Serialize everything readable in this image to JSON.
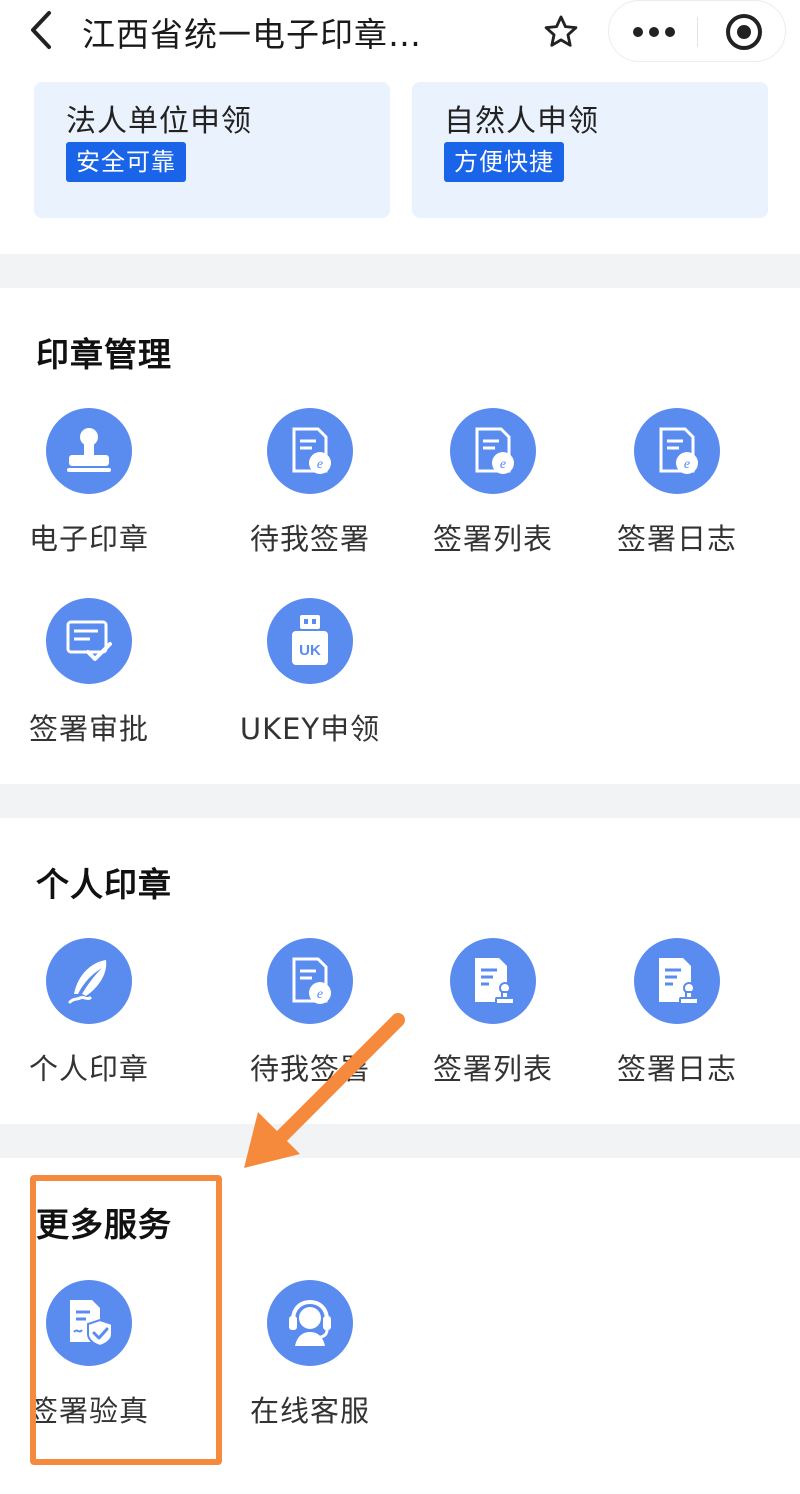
{
  "header": {
    "title": "江西省统一电子印章…",
    "back_icon": "chevron-left-icon",
    "star_icon": "star-icon",
    "more_icon": "more-dots-icon",
    "close_icon": "target-circle-icon"
  },
  "apply_cards": [
    {
      "title": "法人单位申领",
      "tag": "安全可靠"
    },
    {
      "title": "自然人申领",
      "tag": "方便快捷"
    }
  ],
  "sections": {
    "seal_management": {
      "title": "印章管理",
      "items": [
        {
          "label": "电子印章",
          "icon": "stamp-icon"
        },
        {
          "label": "待我签署",
          "icon": "e-sign-document-icon"
        },
        {
          "label": "签署列表",
          "icon": "e-sign-document-icon"
        },
        {
          "label": "签署日志",
          "icon": "e-sign-document-icon"
        },
        {
          "label": "签署审批",
          "icon": "approval-check-icon"
        },
        {
          "label": "UKEY申领",
          "icon": "usb-key-icon"
        }
      ]
    },
    "personal_seal": {
      "title": "个人印章",
      "items": [
        {
          "label": "个人印章",
          "icon": "feather-pen-icon"
        },
        {
          "label": "待我签署",
          "icon": "e-sign-document-icon"
        },
        {
          "label": "签署列表",
          "icon": "document-stamp-icon"
        },
        {
          "label": "签署日志",
          "icon": "document-stamp-icon"
        }
      ]
    },
    "more_services": {
      "title": "更多服务",
      "items": [
        {
          "label": "签署验真",
          "icon": "document-shield-icon"
        },
        {
          "label": "在线客服",
          "icon": "headset-agent-icon"
        }
      ]
    }
  },
  "colors": {
    "accent_blue": "#1964e8",
    "icon_blue": "#5a8bef",
    "card_bg": "#eaf3fd",
    "annotation_orange": "#f58a3c"
  }
}
